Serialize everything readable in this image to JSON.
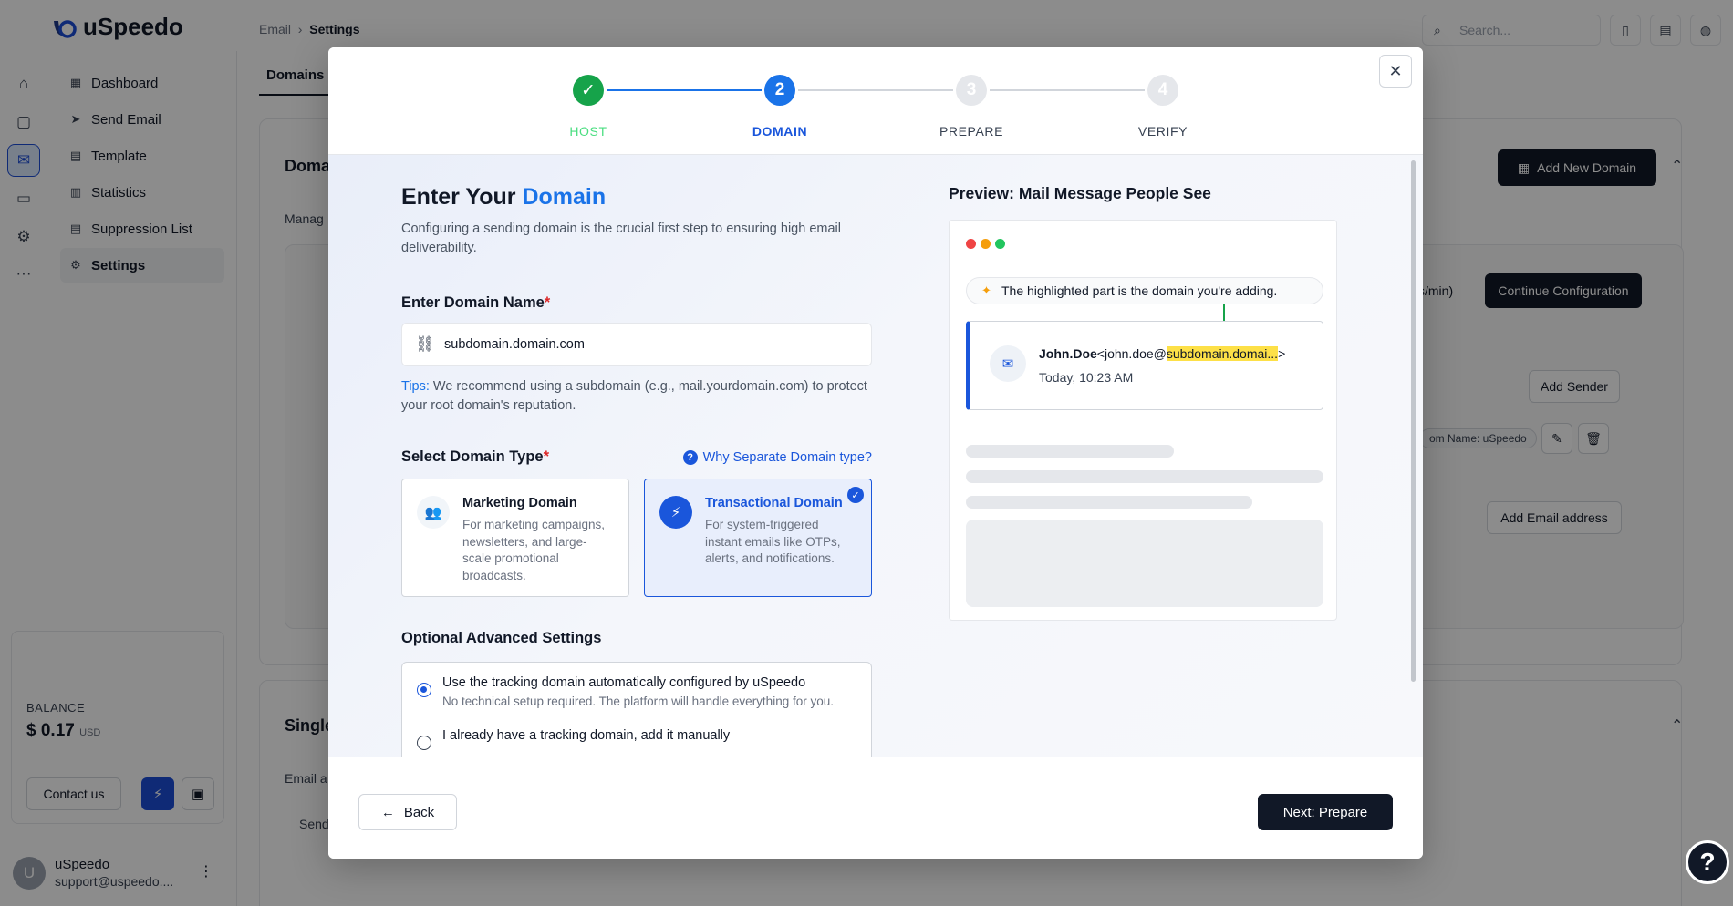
{
  "app": {
    "logo": "uSpeedo",
    "nav": [
      "Dashboard",
      "Send Email",
      "Template",
      "Statistics",
      "Suppression List",
      "Settings"
    ],
    "balance_label": "BALANCE",
    "balance_value": "$ 0.17",
    "balance_unit": "USD",
    "contact": "Contact us",
    "user_initial": "U",
    "user_name": "uSpeedo",
    "user_email": "support@uspeedo....",
    "breadcrumb_parent": "Email",
    "breadcrumb_current": "Settings",
    "search_placeholder": "Search...",
    "tab": "Domains &",
    "section1": "Doma",
    "section1_desc": "Manag",
    "add_domain": "Add New Domain",
    "speed_fragment": "s/min)",
    "continue_config": "Continue Configuration",
    "add_sender": "Add Sender",
    "sender_tag": "om Name:  uSpeedo",
    "add_email": "Add Email address",
    "section2": "Single",
    "section2_desc": "Email a",
    "section2_col": "Send"
  },
  "modal": {
    "steps": [
      {
        "num": "✓",
        "label": "HOST",
        "state": "done"
      },
      {
        "num": "2",
        "label": "DOMAIN",
        "state": "current"
      },
      {
        "num": "3",
        "label": "PREPARE",
        "state": "todo"
      },
      {
        "num": "4",
        "label": "VERIFY",
        "state": "todo"
      }
    ],
    "title_prefix": "Enter Your",
    "title_accent": "Domain",
    "subtitle": "Configuring a sending domain is the crucial first step to ensuring high email deliverability.",
    "domain_label": "Enter Domain Name",
    "domain_value": "subdomain.domain.com",
    "tips_label": "Tips:",
    "tips_text": " We recommend using a subdomain (e.g., mail.yourdomain.com) to protect your root domain's reputation.",
    "type_label": "Select Domain Type",
    "why_link": "Why Separate Domain type?",
    "types": [
      {
        "title": "Marketing Domain",
        "desc": "For marketing campaigns, newsletters, and large-scale promotional broadcasts.",
        "selected": false
      },
      {
        "title": "Transactional Domain",
        "desc": "For system-triggered instant emails like OTPs, alerts, and notifications.",
        "selected": true
      }
    ],
    "advanced_label": "Optional Advanced Settings",
    "options": [
      {
        "title": "Use the tracking domain automatically configured by uSpeedo",
        "desc": "No technical setup required. The platform will handle everything for you.",
        "selected": true
      },
      {
        "title": "I already have a tracking domain, add it manually",
        "desc": "",
        "selected": false
      }
    ],
    "preview_title": "Preview: Mail Message People See",
    "preview_hint": "The highlighted part is the domain you're adding.",
    "mail_name": "John.Doe",
    "mail_addr_prefix": "<john.doe@",
    "mail_domain": "subdomain.domai...",
    "mail_addr_suffix": ">",
    "mail_time": "Today, 10:23 AM",
    "back": "Back",
    "next": "Next: Prepare",
    "colors": {
      "accent": "#1a73e8",
      "done": "#16a34a",
      "highlight": "#fde047",
      "primary_btn": "#111827"
    }
  }
}
